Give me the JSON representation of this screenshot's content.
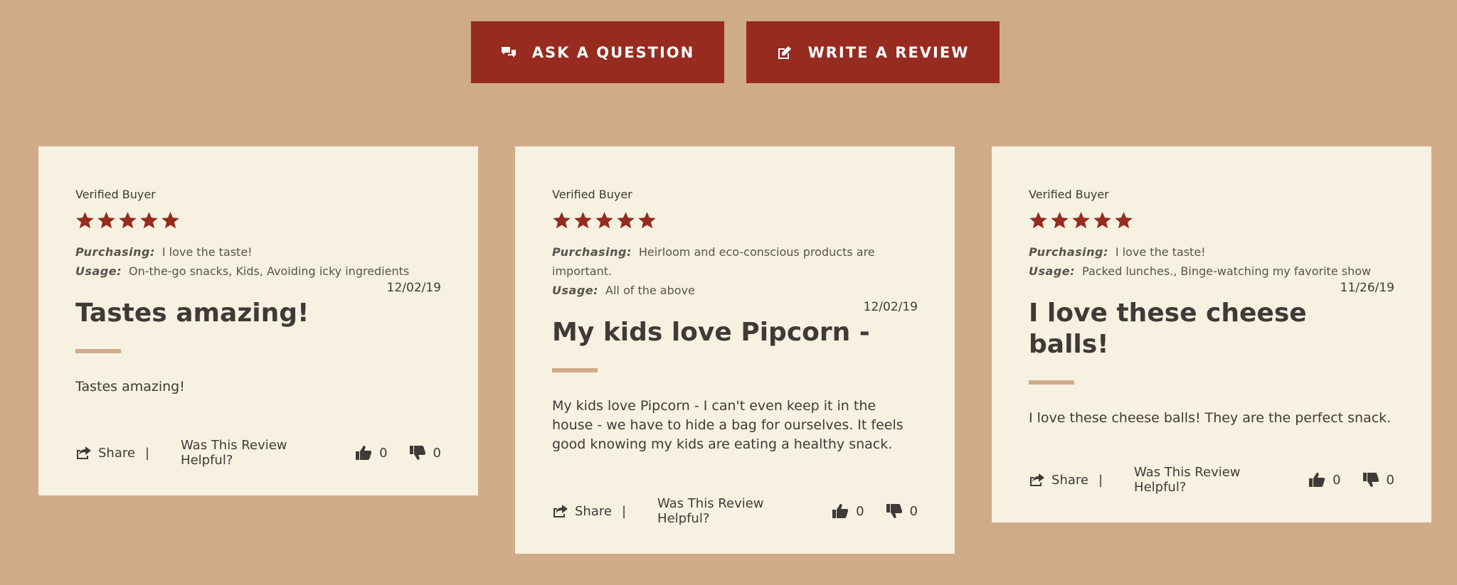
{
  "actions": {
    "ask_label": "ASK A QUESTION",
    "write_label": "WRITE A REVIEW"
  },
  "colors": {
    "accent": "#972b1f",
    "background": "#d0ab89",
    "card": "#f6f1e1",
    "text": "#3f3a37"
  },
  "reviews": [
    {
      "verified": "Verified Buyer",
      "rating": 5,
      "purchasing_label": "Purchasing:",
      "purchasing": "I love the taste!",
      "usage_label": "Usage:",
      "usage": "On-the-go snacks, Kids, Avoiding icky ingredients",
      "date": "12/02/19",
      "title": "Tastes amazing!",
      "body": "Tastes amazing!",
      "share_label": "Share",
      "divider": "|",
      "helpful_label": "Was This Review Helpful?",
      "up_count": "0",
      "down_count": "0"
    },
    {
      "verified": "Verified Buyer",
      "rating": 5,
      "purchasing_label": "Purchasing:",
      "purchasing": "Heirloom and eco-conscious products are important.",
      "usage_label": "Usage:",
      "usage": "All of the above",
      "date": "12/02/19",
      "title": "My kids love Pipcorn -",
      "body": "My kids love Pipcorn - I can't even keep it in the house - we have to hide a bag for ourselves. It feels good knowing my kids are eating a healthy snack.",
      "share_label": "Share",
      "divider": "|",
      "helpful_label": "Was This Review Helpful?",
      "up_count": "0",
      "down_count": "0"
    },
    {
      "verified": "Verified Buyer",
      "rating": 5,
      "purchasing_label": "Purchasing:",
      "purchasing": "I love the taste!",
      "usage_label": "Usage:",
      "usage": "Packed lunches., Binge-watching my favorite show",
      "date": "11/26/19",
      "title": "I love these cheese balls!",
      "body": "I love these cheese balls! They are the perfect snack.",
      "share_label": "Share",
      "divider": "|",
      "helpful_label": "Was This Review Helpful?",
      "up_count": "0",
      "down_count": "0"
    }
  ]
}
